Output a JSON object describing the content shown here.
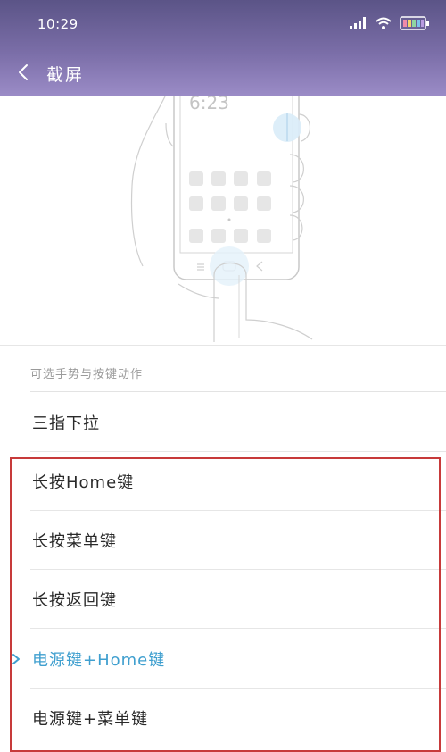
{
  "status": {
    "time": "10:29"
  },
  "nav": {
    "title": "截屏"
  },
  "illustration": {
    "phone_time": "6:23"
  },
  "section": {
    "header": "可选手势与按键动作"
  },
  "options": [
    {
      "label": "三指下拉",
      "selected": false
    },
    {
      "label": "长按Home键",
      "selected": false
    },
    {
      "label": "长按菜单键",
      "selected": false
    },
    {
      "label": "长按返回键",
      "selected": false
    },
    {
      "label": "电源键+Home键",
      "selected": true
    },
    {
      "label": "电源键+菜单键",
      "selected": false
    }
  ],
  "colors": {
    "accent": "#3f9fcf",
    "header_top": "#5b5487",
    "header_bottom": "#9b8cc7",
    "highlight": "#c73a3a"
  },
  "icons": {
    "back": "chevron-left-icon",
    "signal": "signal-icon",
    "wifi": "wifi-icon",
    "battery": "battery-icon",
    "selected": "check-chevron-icon"
  }
}
